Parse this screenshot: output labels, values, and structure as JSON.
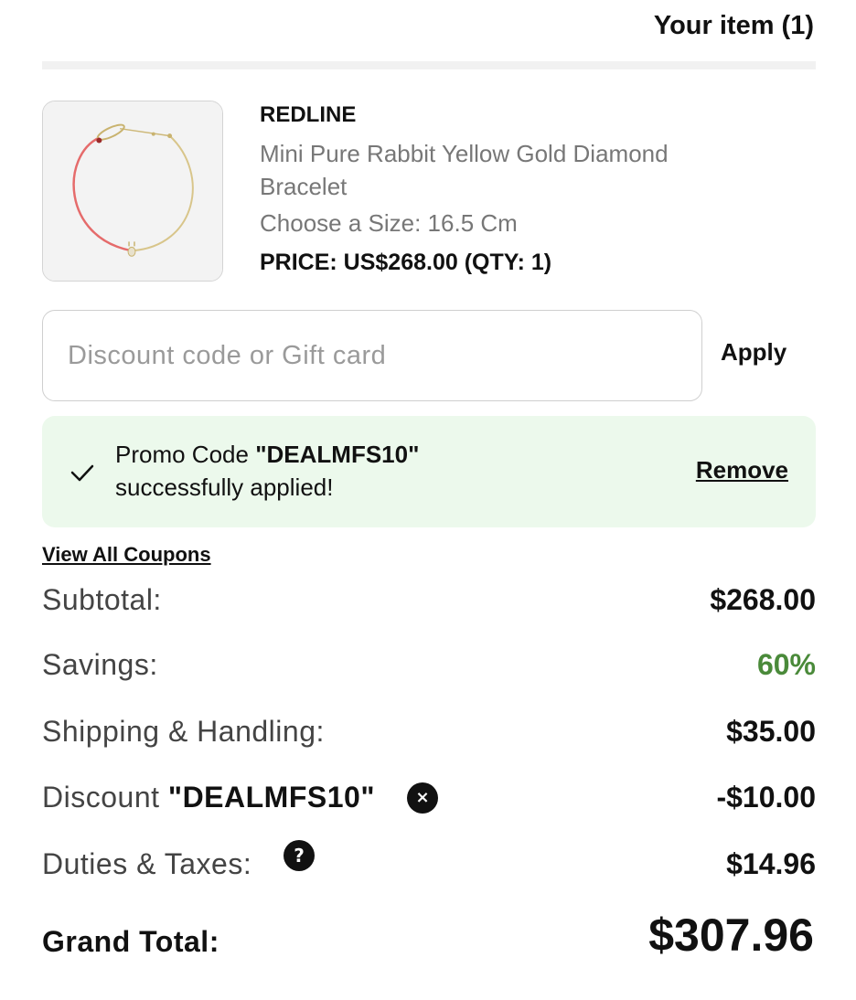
{
  "header": {
    "title": "Your item (1)"
  },
  "product": {
    "brand": "REDLINE",
    "name": "Mini Pure Rabbit Yellow Gold Diamond Bracelet",
    "size": "Choose a Size: 16.5 Cm",
    "price": "PRICE: US$268.00 (QTY: 1)",
    "image_icon": "bracelet-image"
  },
  "discount": {
    "placeholder": "Discount code or Gift card",
    "value": "",
    "apply_label": "Apply"
  },
  "promo": {
    "prefix": "Promo Code ",
    "code": "\"DEALMFS10\"",
    "suffix": "successfully applied!",
    "remove_label": "Remove",
    "icon": "checkmark-icon"
  },
  "coupons_link": "View All Coupons",
  "summary": {
    "subtotal_label": "Subtotal:",
    "subtotal_value": "$268.00",
    "savings_label": "Savings:",
    "savings_value": "60%",
    "shipping_label": "Shipping & Handling:",
    "shipping_value": "$35.00",
    "discount_label_prefix": "Discount ",
    "discount_code": "\"DEALMFS10\"",
    "discount_value": "-$10.00",
    "duties_label": "Duties & Taxes:",
    "duties_value": "$14.96",
    "remove_discount_icon": "×",
    "help_icon": "?",
    "grand_total_label": "Grand Total:",
    "grand_total_value": "$307.96"
  },
  "colors": {
    "promo_background": "#ecf9ec",
    "savings_green": "#4a8a3a",
    "muted_text": "#777777"
  }
}
